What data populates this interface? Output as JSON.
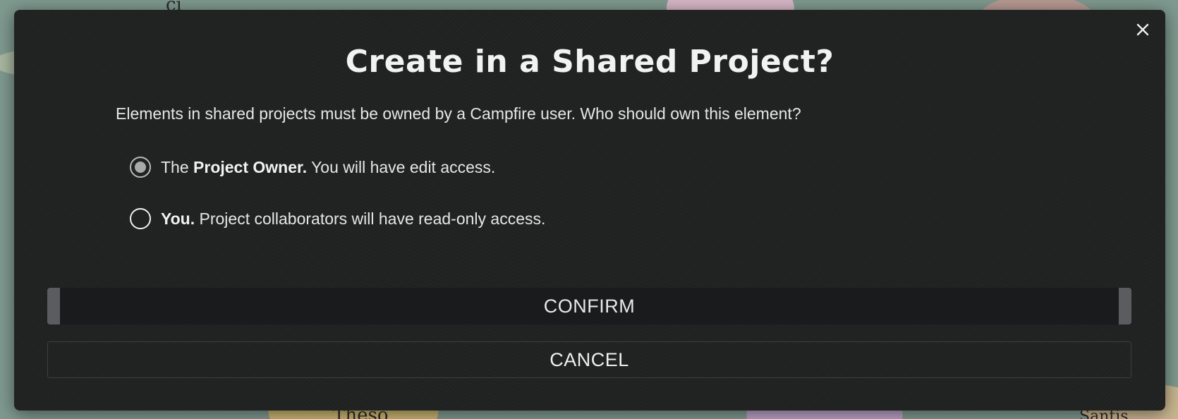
{
  "backdrop": {
    "map_labels": [
      "ci",
      "Theso",
      "Santis"
    ]
  },
  "dialog": {
    "title": "Create in a Shared Project?",
    "description": "Elements in shared projects must be owned by a Campfire user. Who should own this element?",
    "options": [
      {
        "bold": "Project Owner.",
        "prefix": "The ",
        "rest": " You will have edit access.",
        "checked": true
      },
      {
        "bold": "You.",
        "prefix": "",
        "rest": " Project collaborators will have read-only access.",
        "checked": false
      }
    ],
    "confirm_label": "CONFIRM",
    "cancel_label": "CANCEL",
    "close_icon": "close-icon"
  },
  "colors": {
    "modal_bg": "#202121",
    "confirm_bg": "#1a1b1d",
    "confirm_side": "#5a5c60",
    "text": "#e6e6e6"
  }
}
